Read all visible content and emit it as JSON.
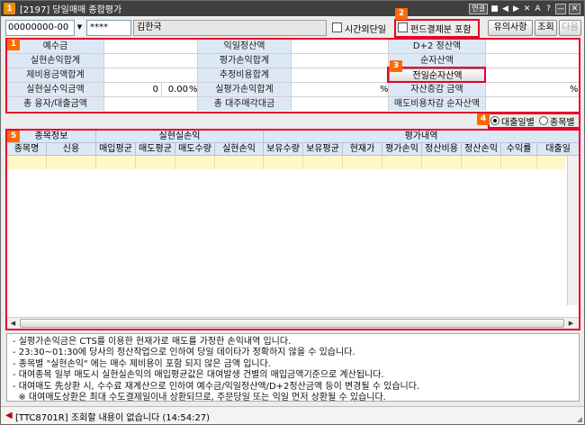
{
  "window": {
    "number": "1",
    "title": "[2197] 당일매매 종합평가",
    "title_icons": [
      "■",
      "◀",
      "▶",
      "✕",
      "A",
      "?",
      "—"
    ]
  },
  "titlebar_actions": {
    "link": "연결",
    "min": "—",
    "close": "✕"
  },
  "toolbar": {
    "account": "00000000-00",
    "password": "****",
    "holder_name": "김한국",
    "after_hours_label": "시간외단일",
    "fund_settle_label": "펀드결제분 포함",
    "notice_button": "유의사항",
    "query_button": "조회",
    "next_button": "다음"
  },
  "badges": [
    "1",
    "2",
    "3",
    "4",
    "5"
  ],
  "summary": {
    "rows": [
      [
        "예수금",
        "",
        "익일정산액",
        "",
        "D+2 정산액",
        ""
      ],
      [
        "실현손익합계",
        "",
        "평가손익합계",
        "",
        "순자산액",
        ""
      ],
      [
        "제비용금액합계",
        "",
        "추정비용합계",
        "",
        "전일순자산액",
        ""
      ],
      [
        "실현실수익금액",
        "0",
        "실평가손익합계",
        "",
        "자산증감 금액",
        ""
      ],
      [
        "총 융자/대출금액",
        "",
        "총 대주매각대금",
        "",
        "매도비용차감 순자산액",
        ""
      ]
    ],
    "rate_value": "0.00",
    "percent": "%"
  },
  "view_mode": {
    "options": [
      "대출일별",
      "종목별"
    ],
    "selected": "대출일별"
  },
  "grid": {
    "group_headers": [
      "종목정보",
      "실현실손익",
      "평가내역"
    ],
    "columns": [
      "종목명",
      "신용",
      "매입평균",
      "매도평균",
      "매도수량",
      "실현손익",
      "보유수량",
      "보유평균",
      "현재가",
      "평가손익",
      "정산비용",
      "정산손익",
      "수익률",
      "대출일"
    ]
  },
  "notes": [
    "- 실평가손익금은 CTS를 이용한 현재가로 매도를 가정한 손익내역 입니다.",
    "- 23:30~01:30에 당사의 정산작업으로 인하여 당일 데이타가 정확하지 않을 수 있습니다.",
    "- 종목별 \"실현손익\" 에는 매수 제비용이 포함 되지 않은 금액 입니다.",
    "- 대여종목 일부 매도시 실현실손익의 매입평균값은 대여발생 건별의 매입금액기준으로 계산됩니다.",
    "- 대여매도 先상환 시, 수수료 재계산으로 인하여 예수금/익일정산액/D+2정산금액 등이 변경될 수 있습니다.",
    "  ※ 대여매도상환은 최대 수도결제일이내 상환되므로, 주문당일 또는 익일 먼저 상환될 수 있습니다."
  ],
  "status": {
    "text": "[TTC8701R] 조회할 내용이 없습니다 (14:54:27)"
  }
}
